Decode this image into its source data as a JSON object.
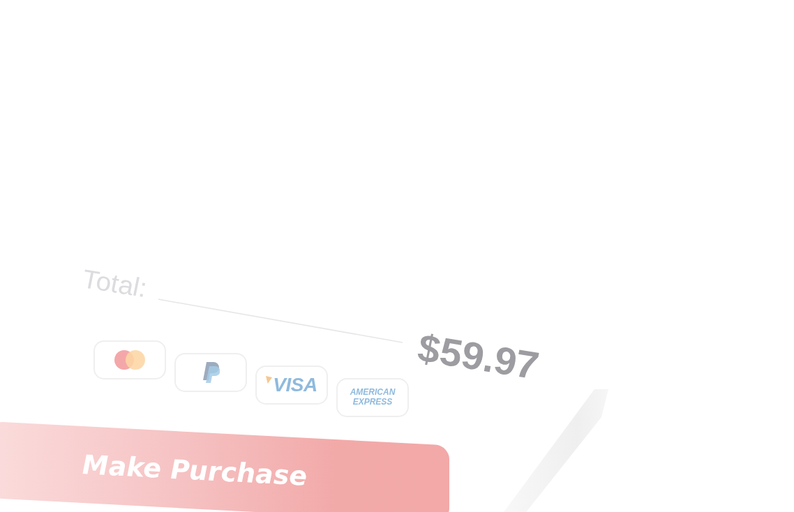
{
  "total": {
    "label": "Total:",
    "amount": "$59.97"
  },
  "payment_methods": [
    {
      "kind": "circles"
    },
    {
      "kind": "letter"
    },
    {
      "kind": "flagged",
      "label": "VISA"
    },
    {
      "kind": "stacked",
      "label": "AMERICAN EXPRESS"
    }
  ],
  "purchase_button": {
    "label": "Make Purchase"
  }
}
